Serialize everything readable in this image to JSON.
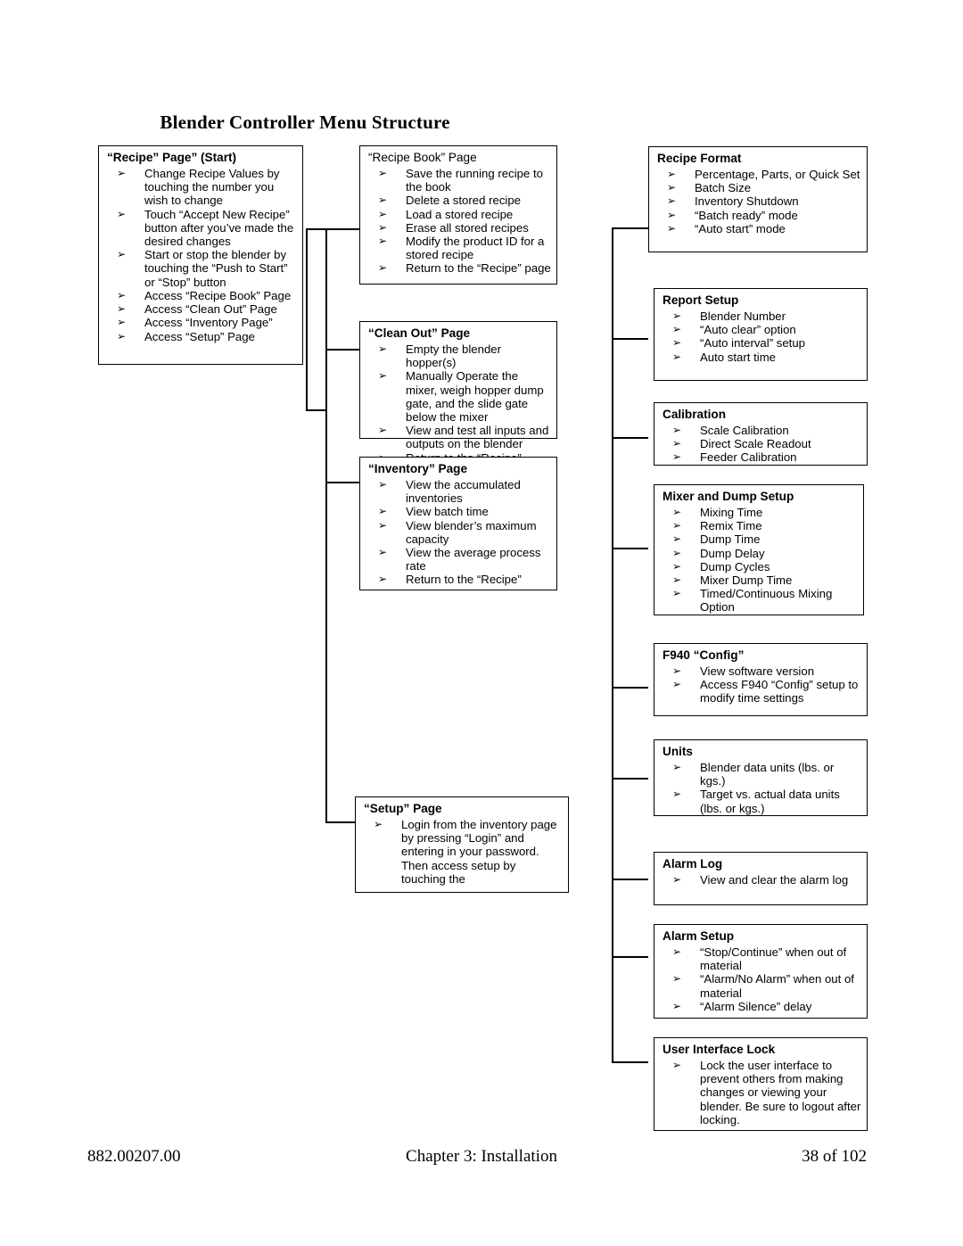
{
  "title": "Blender Controller Menu Structure",
  "bullet_glyph": "➢",
  "footer": {
    "doc_number": "882.00207.00",
    "chapter": "Chapter 3: Installation",
    "page": "38 of 102"
  },
  "boxes": {
    "recipe_page": {
      "title": "“Recipe” Page” (Start)",
      "title_bold": true,
      "items": [
        "Change Recipe Values by touching the number you wish to change",
        "Touch “Accept New Recipe” button after you’ve made the desired changes",
        "Start or stop the blender by touching the “Push to Start” or “Stop” button",
        "Access “Recipe Book” Page",
        "Access “Clean Out” Page",
        "Access “Inventory Page”",
        "Access “Setup” Page"
      ]
    },
    "recipe_book": {
      "title": "“Recipe Book” Page",
      "title_bold": false,
      "items": [
        "Save the running recipe to the book",
        "Delete a stored recipe",
        "Load a stored recipe",
        "Erase all stored recipes",
        "Modify the product ID for a stored recipe",
        "Return to the “Recipe” page"
      ]
    },
    "clean_out": {
      "title": "“Clean Out” Page",
      "title_bold": true,
      "items": [
        "Empty the blender hopper(s)",
        "Manually Operate the mixer, weigh hopper dump gate, and the slide gate below the mixer",
        "View and test all inputs and outputs on the blender",
        "Return to the “Recipe” Page"
      ]
    },
    "inventory": {
      "title": "“Inventory” Page",
      "title_bold": true,
      "items": [
        "View the accumulated inventories",
        "View batch time",
        "View blender’s maximum capacity",
        "View the average process rate",
        "Return to the “Recipe”"
      ]
    },
    "setup": {
      "title": "“Setup” Page",
      "title_bold": true,
      "items": [
        "Login from the inventory page by pressing “Login” and entering in your password.  Then access setup by touching the"
      ]
    },
    "recipe_format": {
      "title": "Recipe Format",
      "title_bold": true,
      "items": [
        "Percentage, Parts, or Quick Set",
        "Batch Size",
        "Inventory Shutdown",
        "“Batch ready” mode",
        "“Auto start” mode"
      ]
    },
    "report_setup": {
      "title": "Report Setup",
      "title_bold": true,
      "items": [
        "Blender Number",
        "“Auto clear” option",
        "“Auto interval” setup",
        "Auto start time"
      ]
    },
    "calibration": {
      "title": "Calibration",
      "title_bold": true,
      "items": [
        "Scale Calibration",
        "Direct Scale Readout",
        "Feeder Calibration"
      ]
    },
    "mixer_dump": {
      "title": "Mixer and Dump Setup",
      "title_bold": true,
      "items": [
        "Mixing Time",
        "Remix Time",
        "Dump Time",
        "Dump Delay",
        "Dump Cycles",
        "Mixer Dump Time",
        "Timed/Continuous Mixing Option"
      ]
    },
    "f940_config": {
      "title": "F940 “Config”",
      "title_bold": true,
      "items": [
        "View software version",
        "Access F940 “Config” setup to modify time settings"
      ]
    },
    "units": {
      "title": "Units",
      "title_bold": true,
      "items": [
        "Blender data units (lbs. or kgs.)",
        "Target vs. actual data units (lbs. or kgs.)"
      ]
    },
    "alarm_log": {
      "title": "Alarm Log",
      "title_bold": true,
      "items": [
        "View and clear the alarm log"
      ]
    },
    "alarm_setup": {
      "title": "Alarm Setup",
      "title_bold": true,
      "items": [
        "“Stop/Continue” when out of material",
        "“Alarm/No Alarm” when out of material",
        "“Alarm Silence” delay"
      ]
    },
    "ui_lock": {
      "title": "User Interface Lock",
      "title_bold": true,
      "items": [
        "Lock the user interface to prevent others from making changes or viewing your blender.  Be sure to logout after locking."
      ]
    }
  }
}
